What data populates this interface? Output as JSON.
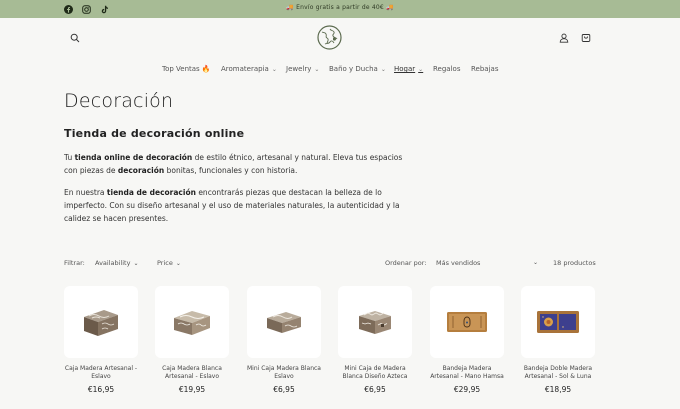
{
  "topbar": {
    "announcement": "🚚 Envío gratis a partir de 40€ 🚚",
    "social": [
      "facebook-icon",
      "instagram-icon",
      "tiktok-icon"
    ],
    "background": "#a7bb95"
  },
  "header": {
    "icons": [
      "search-icon",
      "account-icon",
      "cart-icon"
    ]
  },
  "nav": {
    "items": [
      {
        "label": "Top Ventas 🔥",
        "dropdown": false
      },
      {
        "label": "Aromaterapia",
        "dropdown": true
      },
      {
        "label": "Jewelry",
        "dropdown": true
      },
      {
        "label": "Baño y Ducha",
        "dropdown": true
      },
      {
        "label": "Hogar",
        "dropdown": true,
        "active": true
      },
      {
        "label": "Regalos",
        "dropdown": false
      },
      {
        "label": "Rebajas",
        "dropdown": false
      }
    ]
  },
  "page": {
    "title": "Decoración",
    "subtitle": "Tienda de decoración online",
    "p1_a": "Tu ",
    "p1_b": "tienda online de decoración",
    "p1_c": " de estilo étnico, artesanal y natural. Eleva tus espacios con piezas de ",
    "p1_d": "decoración",
    "p1_e": " bonitas, funcionales y con historia.",
    "p2_a": "En nuestra ",
    "p2_b": "tienda de decoración",
    "p2_c": " encontrarás piezas que destacan la belleza de lo imperfecto. Con su diseño artesanal y el uso de materiales naturales, la autenticidad y la calidez se hacen presentes."
  },
  "filters": {
    "label": "Filtrar:",
    "availability": "Availability",
    "price": "Price",
    "sort_label": "Ordenar por:",
    "sort_value": "Más vendidos",
    "count": "18 productos"
  },
  "products": [
    {
      "name": "Caja Madera Artesanal - Eslavo",
      "price": "€16,95",
      "image": "wood-box"
    },
    {
      "name": "Caja Madera Blanca Artesanal - Eslavo",
      "price": "€19,95",
      "image": "wood-box"
    },
    {
      "name": "Mini Caja Madera Blanca Eslavo",
      "price": "€6,95",
      "image": "wood-box"
    },
    {
      "name": "Mini Caja de Madera Blanca Diseño Azteca",
      "price": "€6,95",
      "image": "wood-box"
    },
    {
      "name": "Bandeja Madera Artesanal - Mano Hamsa",
      "price": "€29,95",
      "image": "tray"
    },
    {
      "name": "Bandeja Doble Madera Artesanal - Sol & Luna",
      "price": "€18,95",
      "image": "double-tray"
    }
  ]
}
